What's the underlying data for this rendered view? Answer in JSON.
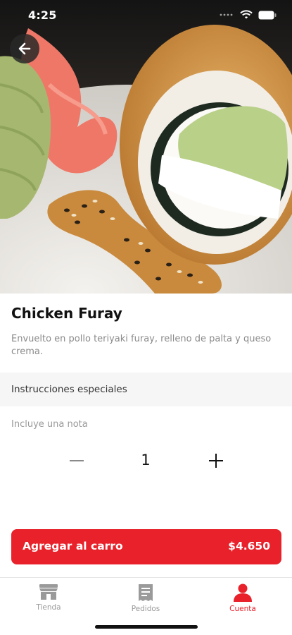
{
  "status_bar": {
    "time": "4:25"
  },
  "product": {
    "name": "Chicken Furay",
    "description": "Envuelto en pollo teriyaki furay, relleno de palta y queso crema."
  },
  "instructions": {
    "label": "Instrucciones especiales",
    "placeholder": "Incluye una nota"
  },
  "quantity": {
    "value": "1"
  },
  "cart_button": {
    "label": "Agregar al carro",
    "price": "$4.650"
  },
  "bottom_nav": {
    "items": [
      {
        "label": "Tienda",
        "icon": "store-icon"
      },
      {
        "label": "Pedidos",
        "icon": "receipt-icon"
      },
      {
        "label": "Cuenta",
        "icon": "person-icon",
        "active": true
      }
    ]
  },
  "colors": {
    "accent": "#e8212a",
    "inactive": "#9a9a9a"
  }
}
